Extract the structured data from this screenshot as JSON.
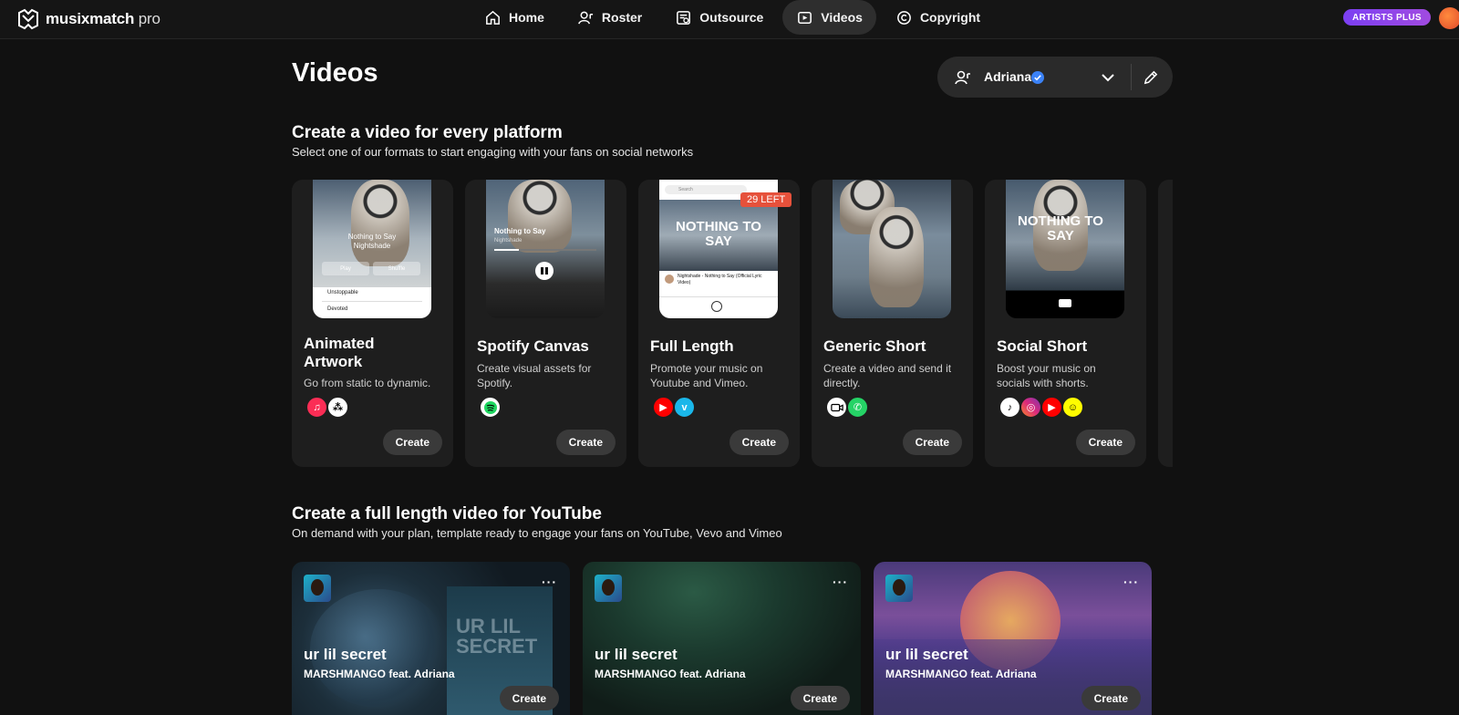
{
  "brand": {
    "name_bold": "musixmatch",
    "name_light": "pro",
    "logo_icon": "musixmatch-logo"
  },
  "nav": [
    {
      "label": "Home",
      "icon": "home-icon",
      "active": false
    },
    {
      "label": "Roster",
      "icon": "roster-icon",
      "active": false
    },
    {
      "label": "Outsource",
      "icon": "outsource-icon",
      "active": false
    },
    {
      "label": "Videos",
      "icon": "videos-icon",
      "active": true
    },
    {
      "label": "Copyright",
      "icon": "copyright-icon",
      "active": false
    }
  ],
  "plan_badge": "ARTISTS PLUS",
  "page": {
    "title": "Videos"
  },
  "artist_selector": {
    "name": "Adriana",
    "verified": true
  },
  "section1": {
    "title": "Create a video for every platform",
    "subtitle": "Select one of our formats to start engaging with your fans on social networks",
    "cards": [
      {
        "title_l1": "Animated",
        "title_l2": "Artwork",
        "desc": "Go from static to dynamic.",
        "platforms": [
          "apple-music-icon",
          "deezer-icon"
        ],
        "cta": "Create"
      },
      {
        "title_l1": "Spotify Canvas",
        "title_l2": "",
        "desc_l1": "Create visual assets for",
        "desc_l2": "Spotify.",
        "platforms": [
          "spotify-icon"
        ],
        "cta": "Create"
      },
      {
        "title_l1": "Full Length",
        "title_l2": "",
        "desc_l1": "Promote your music on",
        "desc_l2": "Youtube and Vimeo.",
        "platforms": [
          "youtube-icon",
          "vimeo-icon"
        ],
        "cta": "Create",
        "badge": "29 LEFT"
      },
      {
        "title_l1": "Generic Short",
        "title_l2": "",
        "desc_l1": "Create a video and send it",
        "desc_l2": "directly.",
        "platforms": [
          "video-call-icon",
          "whatsapp-icon"
        ],
        "cta": "Create"
      },
      {
        "title_l1": "Social Short",
        "title_l2": "",
        "desc_l1": "Boost your music on",
        "desc_l2": "socials with shorts.",
        "platforms": [
          "tiktok-icon",
          "instagram-icon",
          "youtube-icon",
          "snapchat-icon"
        ],
        "cta": "Create"
      }
    ]
  },
  "section2": {
    "title": "Create a full length video for YouTube",
    "subtitle": "On demand with your plan, template ready to engage your fans on YouTube, Vevo and Vimeo",
    "cards": [
      {
        "title": "ur lil secret",
        "artist": "MARSHMANGO feat. Adriana",
        "cta": "Create",
        "more": "···"
      },
      {
        "title": "ur lil secret",
        "artist": "MARSHMANGO feat. Adriana",
        "cta": "Create",
        "more": "···"
      },
      {
        "title": "ur lil secret",
        "artist": "MARSHMANGO feat. Adriana",
        "cta": "Create",
        "more": "···"
      }
    ]
  },
  "thumb_texts": {
    "song": "Nothing to Say",
    "artist": "Nightshade",
    "play": "Play",
    "shuffle": "Shuffle",
    "track1": "Unstoppable",
    "track2": "Devoted",
    "big_text": "NOTHING TO SAY",
    "yt_search": "Search",
    "yt_video_title": "Nightshade - Nothing to Say (Official Lyric Video)",
    "yt_big1": "UR LIL",
    "yt_big2": "SECRET"
  },
  "colors": {
    "accent": "#7b3ff2",
    "badge": "#e6513b",
    "verified": "#3b82f6"
  }
}
